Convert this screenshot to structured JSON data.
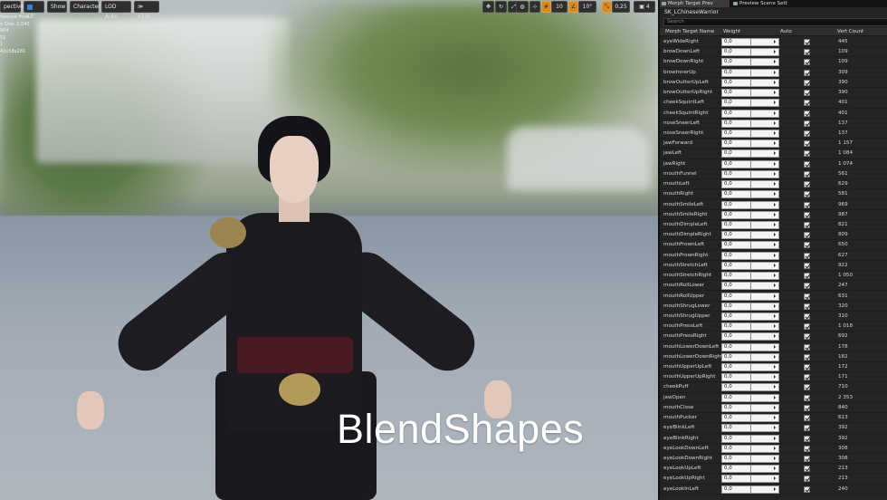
{
  "viewport": {
    "toolbar": {
      "perspective_label": "pective",
      "lit_label": "Lit",
      "show_label": "Show",
      "character_label": "Character",
      "lod_label": "LOD Auto",
      "speed_label": "x1,0"
    },
    "right_toolbar": {
      "grid_value": "10",
      "angle_value": "10°",
      "scale_value": "0,25",
      "camera_speed": "4"
    },
    "info_lines": [
      "ference Pose",
      "n Size: 2,042",
      "964",
      "51",
      "1",
      "42x58x281"
    ],
    "overlay_title": "BlendShapes"
  },
  "panel": {
    "tabs": [
      {
        "label": "Morph Target Prev"
      },
      {
        "label": "Preview Scene Sett"
      }
    ],
    "asset_name": "SK_LChineseWarrior",
    "search_placeholder": "Search",
    "columns": {
      "name": "Morph Target Name",
      "weight": "Weight",
      "auto": "Auto",
      "vert_count": "Vert Count"
    },
    "rows": [
      {
        "name": "eyeWideRight",
        "weight": "0,0",
        "auto": true,
        "verts": "445"
      },
      {
        "name": "browDownLeft",
        "weight": "0,0",
        "auto": true,
        "verts": "109"
      },
      {
        "name": "browDownRight",
        "weight": "0,0",
        "auto": true,
        "verts": "109"
      },
      {
        "name": "browInnerUp",
        "weight": "0,0",
        "auto": true,
        "verts": "309"
      },
      {
        "name": "browOutterUpLeft",
        "weight": "0,0",
        "auto": true,
        "verts": "390"
      },
      {
        "name": "browOutterUpRight",
        "weight": "0,0",
        "auto": true,
        "verts": "390"
      },
      {
        "name": "cheekSquintLeft",
        "weight": "0,0",
        "auto": true,
        "verts": "401"
      },
      {
        "name": "cheekSquintRight",
        "weight": "0,0",
        "auto": true,
        "verts": "401"
      },
      {
        "name": "noseSneerLeft",
        "weight": "0,0",
        "auto": true,
        "verts": "137"
      },
      {
        "name": "noseSneerRight",
        "weight": "0,0",
        "auto": true,
        "verts": "137"
      },
      {
        "name": "jawForward",
        "weight": "0,0",
        "auto": true,
        "verts": "1 157"
      },
      {
        "name": "jawLeft",
        "weight": "0,0",
        "auto": true,
        "verts": "1 084"
      },
      {
        "name": "jawRight",
        "weight": "0,0",
        "auto": true,
        "verts": "1 074"
      },
      {
        "name": "mouthFunnel",
        "weight": "0,0",
        "auto": true,
        "verts": "561"
      },
      {
        "name": "mouthLeft",
        "weight": "0,0",
        "auto": true,
        "verts": "629"
      },
      {
        "name": "mouthRight",
        "weight": "0,0",
        "auto": true,
        "verts": "581"
      },
      {
        "name": "mouthSmileLeft",
        "weight": "0,0",
        "auto": true,
        "verts": "969"
      },
      {
        "name": "mouthSmileRight",
        "weight": "0,0",
        "auto": true,
        "verts": "987"
      },
      {
        "name": "mouthDimpleLeft",
        "weight": "0,0",
        "auto": true,
        "verts": "821"
      },
      {
        "name": "mouthDimpleRight",
        "weight": "0,0",
        "auto": true,
        "verts": "809"
      },
      {
        "name": "mouthFrownLeft",
        "weight": "0,0",
        "auto": true,
        "verts": "650"
      },
      {
        "name": "mouthFrownRight",
        "weight": "0,0",
        "auto": true,
        "verts": "627"
      },
      {
        "name": "mouthStretchLeft",
        "weight": "0,0",
        "auto": true,
        "verts": "922"
      },
      {
        "name": "mouthStretchRight",
        "weight": "0,0",
        "auto": true,
        "verts": "1 050"
      },
      {
        "name": "mouthRollLower",
        "weight": "0,0",
        "auto": true,
        "verts": "247"
      },
      {
        "name": "mouthRollUpper",
        "weight": "0,0",
        "auto": true,
        "verts": "631"
      },
      {
        "name": "mouthShrugLower",
        "weight": "0,0",
        "auto": true,
        "verts": "320"
      },
      {
        "name": "mouthShrugUpper",
        "weight": "0,0",
        "auto": true,
        "verts": "310"
      },
      {
        "name": "mouthPressLeft",
        "weight": "0,0",
        "auto": true,
        "verts": "1 018"
      },
      {
        "name": "mouthPressRight",
        "weight": "0,0",
        "auto": true,
        "verts": "692"
      },
      {
        "name": "mouthLowerDownLeft",
        "weight": "0,0",
        "auto": true,
        "verts": "178"
      },
      {
        "name": "mouthLowerDownRight",
        "weight": "0,0",
        "auto": true,
        "verts": "182"
      },
      {
        "name": "mouthUpperUpLeft",
        "weight": "0,0",
        "auto": true,
        "verts": "172"
      },
      {
        "name": "mouthUpperUpRight",
        "weight": "0,0",
        "auto": true,
        "verts": "171"
      },
      {
        "name": "cheekPuff",
        "weight": "0,0",
        "auto": true,
        "verts": "710"
      },
      {
        "name": "jawOpen",
        "weight": "0,0",
        "auto": true,
        "verts": "2 353"
      },
      {
        "name": "mouthClose",
        "weight": "0,0",
        "auto": true,
        "verts": "840"
      },
      {
        "name": "mouthPucker",
        "weight": "0,0",
        "auto": true,
        "verts": "613"
      },
      {
        "name": "eyeBlinkLeft",
        "weight": "0,0",
        "auto": true,
        "verts": "392"
      },
      {
        "name": "eyeBlinkRight",
        "weight": "0,0",
        "auto": true,
        "verts": "392"
      },
      {
        "name": "eyeLookDownLeft",
        "weight": "0,0",
        "auto": true,
        "verts": "308"
      },
      {
        "name": "eyeLookDownRight",
        "weight": "0,0",
        "auto": true,
        "verts": "308"
      },
      {
        "name": "eyeLookUpLeft",
        "weight": "0,0",
        "auto": true,
        "verts": "213"
      },
      {
        "name": "eyeLookUpRight",
        "weight": "0,0",
        "auto": true,
        "verts": "213"
      },
      {
        "name": "eyeLookInLeft",
        "weight": "0,0",
        "auto": true,
        "verts": "240"
      }
    ]
  }
}
